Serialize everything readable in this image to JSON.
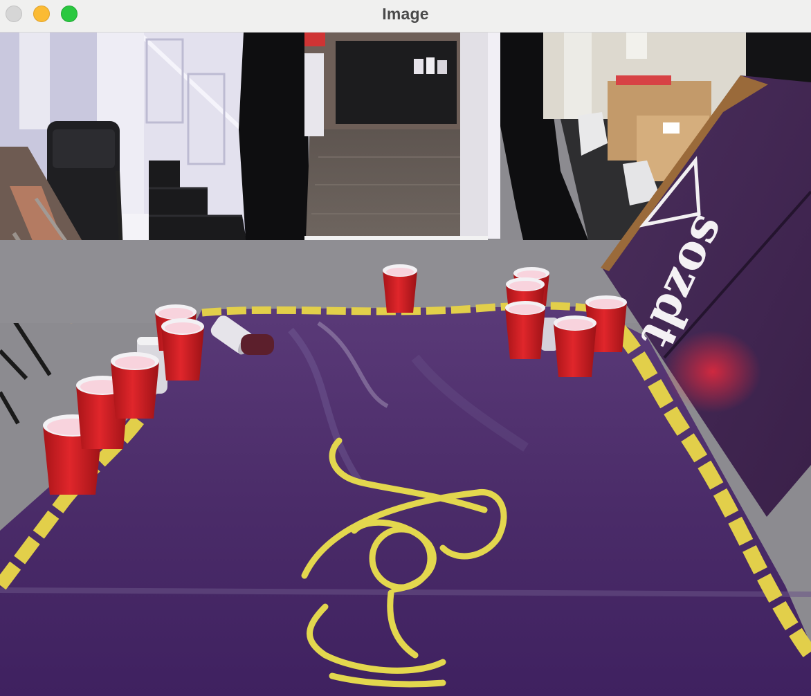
{
  "window": {
    "title": "Image",
    "buttons": {
      "close": "close-button",
      "minimize": "minimize-button",
      "zoom": "zoom-button"
    }
  },
  "photo": {
    "board_text_near": "Ⲫ",
    "board_text_far": "sozdt",
    "colors": {
      "board": "#4a2a66",
      "border_trim": "#e2cf4a",
      "cup": "#d11f23",
      "carpet": "#8b8a8f",
      "curtain": "#111111",
      "wall": "#d9d8e6"
    }
  }
}
